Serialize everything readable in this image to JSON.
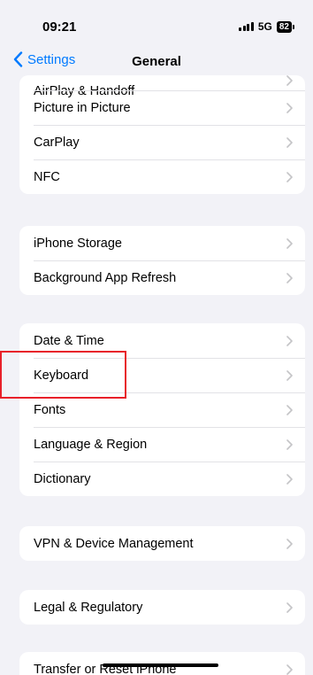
{
  "status": {
    "time": "09:21",
    "network": "5G",
    "battery": "82"
  },
  "nav": {
    "back_label": "Settings",
    "title": "General"
  },
  "groups": [
    {
      "items": [
        "AirPlay & Handoff",
        "Picture in Picture",
        "CarPlay",
        "NFC"
      ]
    },
    {
      "items": [
        "iPhone Storage",
        "Background App Refresh"
      ]
    },
    {
      "items": [
        "Date & Time",
        "Keyboard",
        "Fonts",
        "Language & Region",
        "Dictionary"
      ]
    },
    {
      "items": [
        "VPN & Device Management"
      ]
    },
    {
      "items": [
        "Legal & Regulatory"
      ]
    },
    {
      "items": [
        "Transfer or Reset iPhone"
      ]
    }
  ],
  "colors": {
    "accent": "#007aff",
    "highlight": "#e8202a",
    "background": "#f2f2f7"
  }
}
